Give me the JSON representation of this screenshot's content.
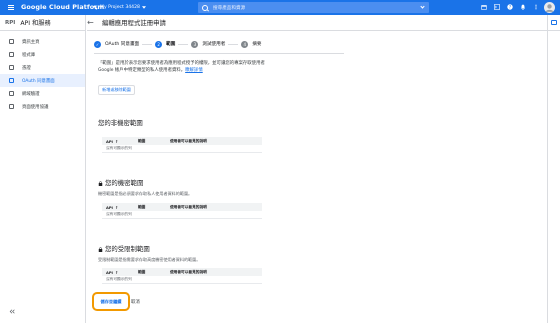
{
  "topbar": {
    "brand": "Google Cloud Platform",
    "project": "My Project 34428",
    "search_placeholder": "搜尋產品和資源"
  },
  "sidebar": {
    "section_badge": "RPI",
    "section_title": "API 和服務",
    "items": [
      {
        "label": "資訊主頁"
      },
      {
        "label": "程式庫"
      },
      {
        "label": "憑證"
      },
      {
        "label": "OAuth 同意畫面"
      },
      {
        "label": "網域驗證"
      },
      {
        "label": "頁面使用協議"
      }
    ],
    "collapse_icon": "collapse-icon"
  },
  "header": {
    "back": "←",
    "title": "編輯應用程式註冊申請"
  },
  "stepper": {
    "steps": [
      {
        "label": "OAuth 同意畫面",
        "marker": "✓"
      },
      {
        "label": "範圍",
        "marker": "2"
      },
      {
        "label": "測試使用者",
        "marker": "3"
      },
      {
        "label": "摘要",
        "marker": "4"
      }
    ]
  },
  "intro": {
    "text": "「範圍」是用於表示您要求使用者為應用程式授予的權限，並可讓您的專案存取使用者 Google 帳戶中特定類型的私人使用者資料。",
    "link": "瞭解詳情"
  },
  "add_scope_label": "新增或移除範圍",
  "sections": [
    {
      "title": "您的非機密範圍",
      "desc": "",
      "empty": "沒有可顯示的列"
    },
    {
      "title": "您的機密範圍",
      "desc": "機密範圍是指必須要求存取私人使用者資料的範圍。",
      "empty": "沒有可顯示的列"
    },
    {
      "title": "您的受限制範圍",
      "desc": "受限制範圍是指需要求存取高度機密使用者資料的範圍。",
      "empty": "沒有可顯示的列"
    }
  ],
  "table_headers": {
    "api": "API",
    "scope": "範圍",
    "desc": "使用者可以看見的說明"
  },
  "actions": {
    "save": "儲存並繼續",
    "cancel": "取消"
  },
  "colors": {
    "accent": "#1a73e8",
    "highlight": "#f29900"
  }
}
